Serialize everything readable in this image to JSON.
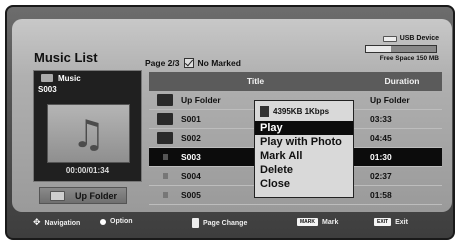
{
  "header": {
    "title": "Music List",
    "page_info": "Page 2/3",
    "marked": "No Marked"
  },
  "usb": {
    "label": "USB Device",
    "free_space": "Free Space 150 MB",
    "used_fraction": 0.35
  },
  "left_panel": {
    "folder_label": "Music",
    "current_item": "S003",
    "time": "00:00/01:34",
    "up_button": "Up Folder"
  },
  "table": {
    "col_title": "Title",
    "col_duration": "Duration",
    "rows": [
      {
        "icon": "up-folder-icon",
        "name": "Up Folder",
        "duration": "Up Folder",
        "selected": false
      },
      {
        "icon": "folder-icon",
        "name": "S001",
        "duration": "03:33",
        "selected": false
      },
      {
        "icon": "folder-icon",
        "name": "S002",
        "duration": "04:45",
        "selected": false
      },
      {
        "icon": "music-file-icon",
        "name": "S003",
        "duration": "01:30",
        "selected": true
      },
      {
        "icon": "music-file-icon",
        "name": "S004",
        "duration": "02:37",
        "selected": false
      },
      {
        "icon": "music-file-icon",
        "name": "S005",
        "duration": "01:58",
        "selected": false
      }
    ]
  },
  "popup": {
    "info": "4395KB 1Kbps",
    "items": [
      "Play",
      "Play with Photo",
      "Mark All",
      "Delete",
      "Close"
    ],
    "active_index": 0
  },
  "footer": {
    "navigation": "Navigation",
    "option": "Option",
    "page_change": "Page Change",
    "mark_key": "MARK",
    "mark": "Mark",
    "exit_key": "EXIT",
    "exit": "Exit"
  }
}
